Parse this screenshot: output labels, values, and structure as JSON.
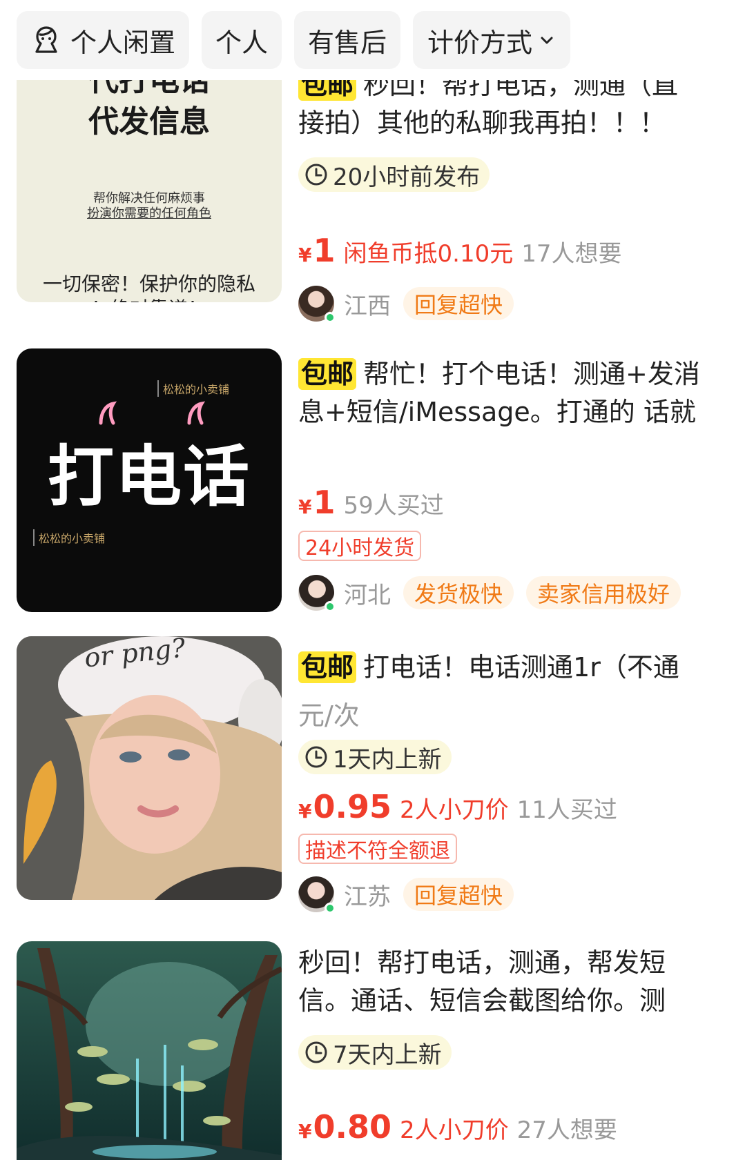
{
  "filters": [
    {
      "label": "个人闲置",
      "icon": "face-icon"
    },
    {
      "label": "个人"
    },
    {
      "label": "有售后"
    },
    {
      "label": "计价方式",
      "icon": "chevron-down-icon"
    }
  ],
  "items": [
    {
      "title_prefix": "包邮",
      "title_line1": "秒回！帮打电话，测通（直",
      "title_line2": "接拍）其他的私聊我再拍！！！",
      "time": "20小时前发布",
      "price": "1",
      "promo": "闲鱼币抵0.10元",
      "meta": "17人想要",
      "region": "江西",
      "badges": [
        "回复超快"
      ],
      "thumb": {
        "line_cut": "代打电话",
        "line_big": "代发信息",
        "sub1": "帮你解决任何麻烦事",
        "sub2": "扮演你需要的任何角色",
        "foot1": "一切保密！保护你的隐私",
        "foot2": "！绝对靠谱！"
      }
    },
    {
      "title_prefix": "包邮",
      "title_line1": "帮忙！打个电话！测通+发消",
      "title_line2": "息+短信/iMessage。打通的 话就",
      "price": "1",
      "meta": "59人买过",
      "tag": "24小时发货",
      "region": "河北",
      "badges": [
        "发货极快",
        "卖家信用极好"
      ],
      "thumb": {
        "shop": "松松的小卖铺",
        "main": "打电话"
      }
    },
    {
      "title_prefix": "包邮",
      "title_line1": "打电话！电话测通1r（不通",
      "title_line2": "元/次",
      "time": "1天内上新",
      "price": "0.95",
      "promo": "2人小刀价",
      "meta": "11人买过",
      "tag": "描述不符全额退",
      "region": "江苏",
      "badges": [
        "回复超快"
      ],
      "thumb": {
        "hat": "or png?"
      }
    },
    {
      "title_line1": "秒回！帮打电话，测通，帮发短",
      "title_line2": "信。通话、短信会截图给你。测",
      "time": "7天内上新",
      "price": "0.80",
      "promo": "2人小刀价",
      "meta": "27人想要"
    }
  ],
  "yen": "¥",
  "colors": {
    "price_red": "#f03d2b",
    "badge_orange": "#f07a16",
    "highlight_yellow": "#ffe633",
    "online_green": "#2dc76d"
  }
}
